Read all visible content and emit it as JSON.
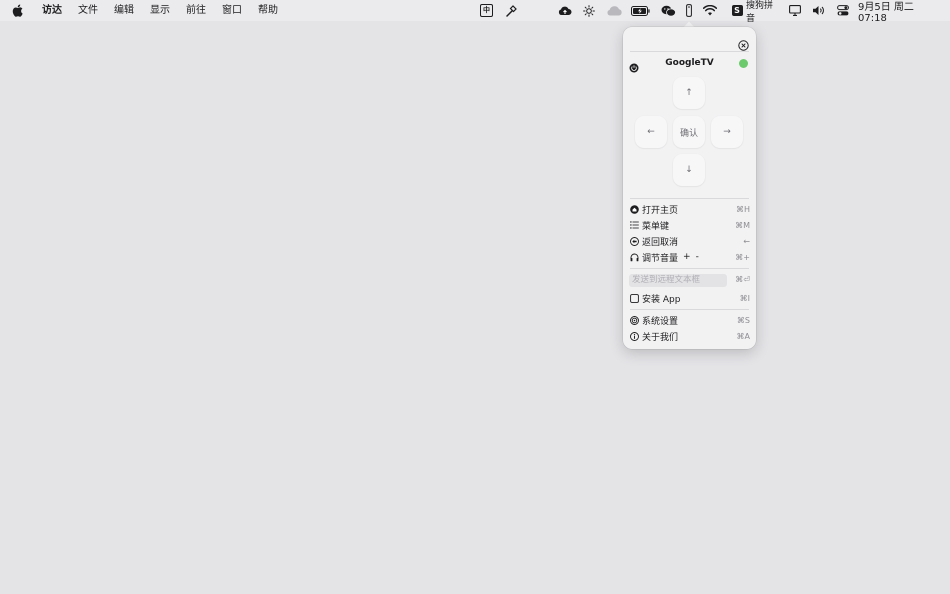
{
  "menubar": {
    "app_name": "访达",
    "items": [
      "文件",
      "编辑",
      "显示",
      "前往",
      "窗口",
      "帮助"
    ],
    "input_method_badge": "中",
    "sogou_label": "搜狗拼音",
    "clock": "9月5日 周二  07:18",
    "icons": [
      "apple-icon",
      "input-method-icon",
      "hammer-icon",
      "cloud-upload-icon",
      "brightness-icon",
      "cloud-icon",
      "battery-icon",
      "wechat-icon",
      "remote-icon",
      "wifi-icon",
      "sogou-icon",
      "display-icon",
      "volume-icon",
      "control-center-icon"
    ]
  },
  "popover": {
    "device_name": "GoogleTV",
    "status_color": "#6cca6c",
    "dpad": {
      "up": "↑",
      "down": "↓",
      "left": "←",
      "right": "→",
      "ok_label": "确认"
    },
    "menu1": [
      {
        "icon": "home-icon",
        "label": "打开主页",
        "shortcut": "⌘H"
      },
      {
        "icon": "list-icon",
        "label": "菜单键",
        "shortcut": "⌘M"
      },
      {
        "icon": "back-icon",
        "label": "返回取消",
        "shortcut": "←"
      },
      {
        "icon": "headphones-icon",
        "label": "调节音量",
        "plus": "+",
        "minus": "-",
        "shortcut": "⌘+"
      }
    ],
    "send_placeholder": "发送到远程文本框",
    "send_shortcut": "⌘⏎",
    "install": {
      "icon": "square-icon",
      "label": "安装 App",
      "shortcut": "⌘I"
    },
    "menu3": [
      {
        "icon": "settings-icon",
        "label": "系统设置",
        "shortcut": "⌘S"
      },
      {
        "icon": "info-icon",
        "label": "关于我们",
        "shortcut": "⌘A"
      }
    ]
  }
}
